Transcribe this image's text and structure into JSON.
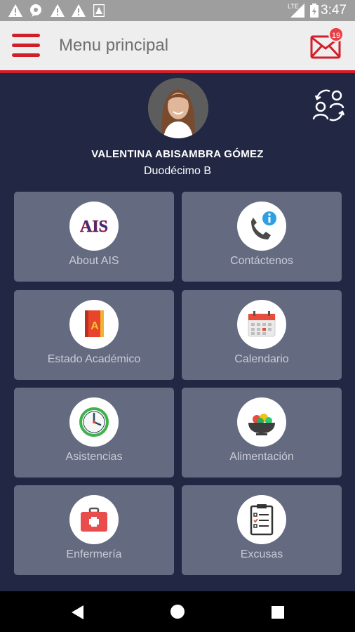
{
  "status_bar": {
    "time": "3:47",
    "network": "LTE",
    "icons": [
      "warning-icon",
      "chat-sync-icon",
      "warning-icon",
      "warning-icon",
      "image-icon",
      "signal-icon",
      "battery-icon"
    ]
  },
  "app_bar": {
    "title": "Menu principal",
    "notification_count": "19",
    "brand_color": "#d11f29"
  },
  "profile": {
    "name": "VALENTINA  ABISAMBRA GÓMEZ",
    "grade": "Duodécimo B"
  },
  "menu_items": [
    {
      "label": "About AIS",
      "icon": "ais-logo-icon",
      "logo_text": "AIS"
    },
    {
      "label": "Contáctenos",
      "icon": "phone-info-icon"
    },
    {
      "label": "Estado Académico",
      "icon": "notebook-icon",
      "logo_text": "A"
    },
    {
      "label": "Calendario",
      "icon": "calendar-icon"
    },
    {
      "label": "Asistencias",
      "icon": "clock-icon"
    },
    {
      "label": "Alimentación",
      "icon": "food-bowl-icon"
    },
    {
      "label": "Enfermería",
      "icon": "first-aid-kit-icon"
    },
    {
      "label": "Excusas",
      "icon": "clipboard-checklist-icon"
    }
  ],
  "colors": {
    "background": "#222844",
    "tile": "#646a80",
    "accent": "#d11f29"
  }
}
